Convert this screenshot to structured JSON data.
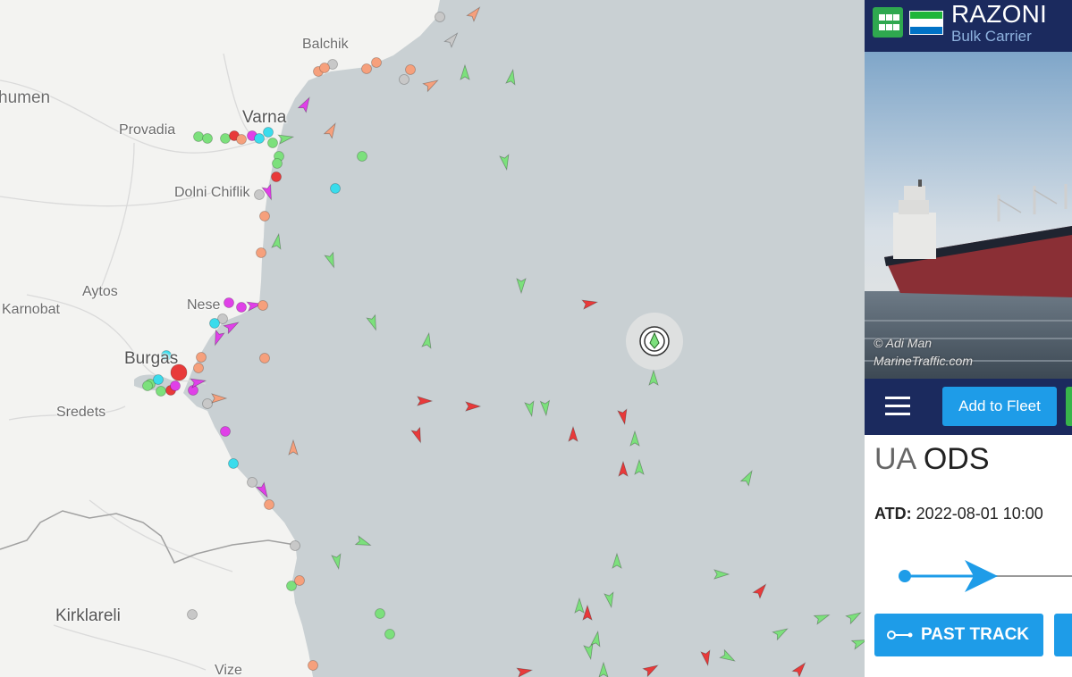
{
  "map": {
    "places": [
      {
        "id": "balchik",
        "label": "Balchik"
      },
      {
        "id": "shumen",
        "label": "humen"
      },
      {
        "id": "provadia",
        "label": "Provadia"
      },
      {
        "id": "varna",
        "label": "Varna"
      },
      {
        "id": "dolni-chiflik",
        "label": "Dolni Chiflik"
      },
      {
        "id": "aytos",
        "label": "Aytos"
      },
      {
        "id": "karnobat",
        "label": "Karnobat"
      },
      {
        "id": "nesebar",
        "label": "Nese"
      },
      {
        "id": "burgas",
        "label": "Burgas"
      },
      {
        "id": "sredets",
        "label": "Sredets"
      },
      {
        "id": "kirklareli",
        "label": "Kirklareli"
      },
      {
        "id": "vize",
        "label": "Vize"
      }
    ],
    "colors": {
      "land": "#f3f3f1",
      "sea": "#c9d0d3",
      "border": "#9a9a9a",
      "cargo": "#7ce07c",
      "tanker": "#e83a3a",
      "passenger": "#3adcec",
      "pleasure": "#e040e8",
      "tug": "#f6a07c",
      "unknown": "#c8c8c8",
      "selected_ring": "#e8e8e8"
    }
  },
  "panel": {
    "vessel_name": "RAZONI",
    "vessel_type": "Bulk Carrier",
    "photo_credit_line1": "© Adi Man",
    "photo_credit_line2": "MarineTraffic.com",
    "add_to_fleet_label": "Add to Fleet",
    "route_from": "UA",
    "route_to": "ODS",
    "atd_label": "ATD:",
    "atd_value": "2022-08-01 10:00",
    "past_track_label": "PAST TRACK",
    "colors": {
      "header": "#1b2a5e",
      "button": "#1e9ce8",
      "grid_button": "#2fa84f",
      "flag": [
        "#1eb53a",
        "#ffffff",
        "#0072c6"
      ]
    },
    "icons": [
      "grid-icon",
      "flag-icon",
      "menu-icon",
      "past-track-icon",
      "progress-arrow-icon"
    ]
  }
}
